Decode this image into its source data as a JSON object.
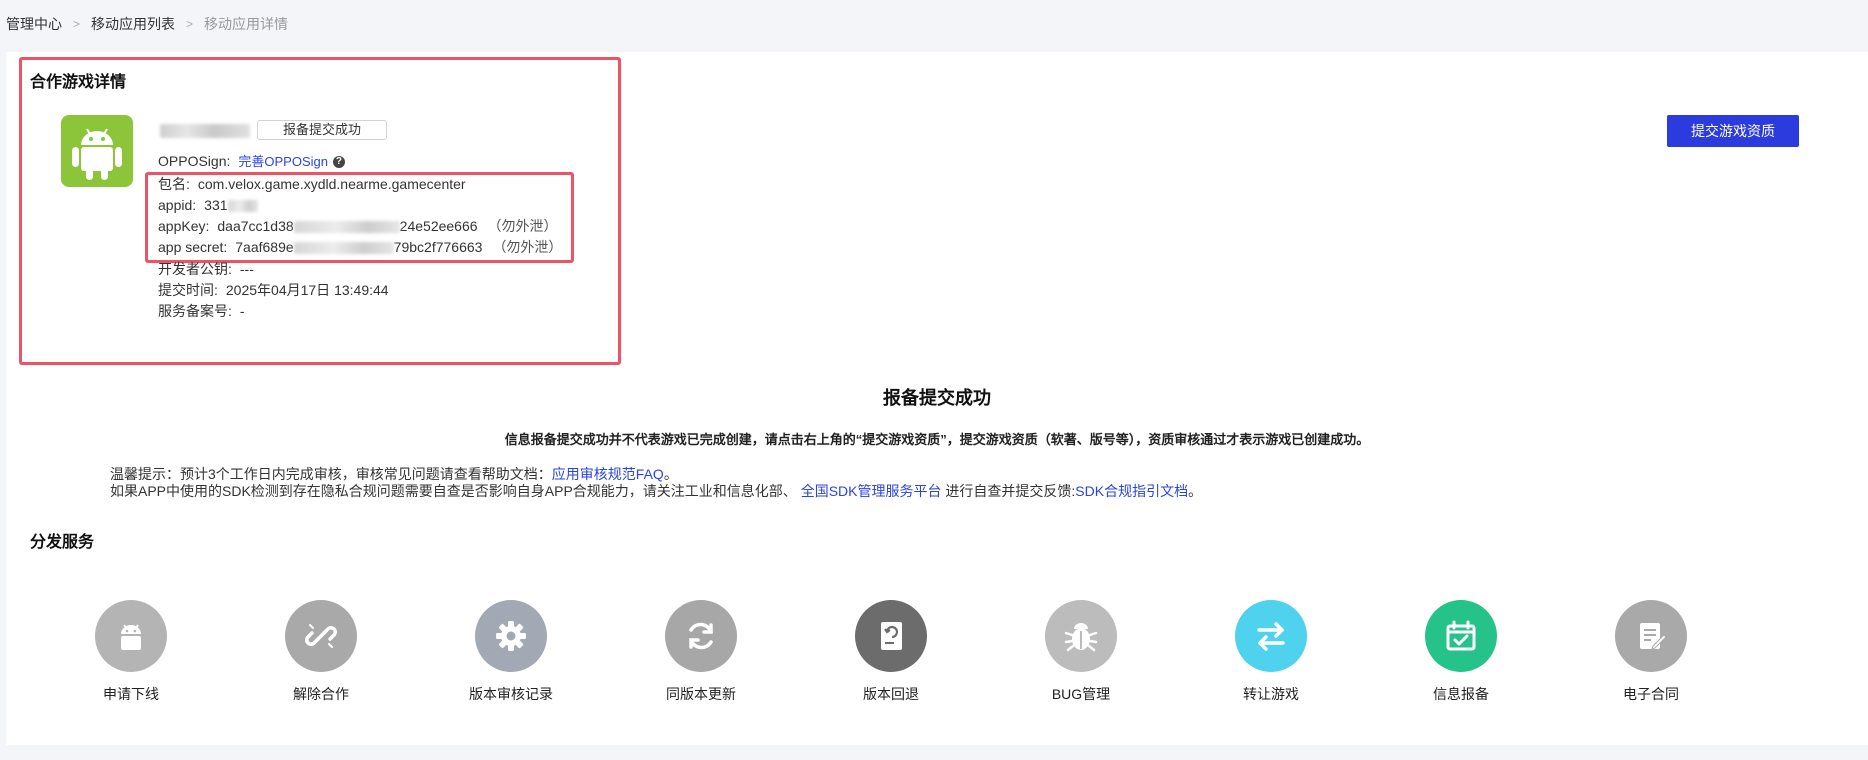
{
  "breadcrumb": {
    "items": [
      "管理中心",
      "移动应用列表",
      "移动应用详情"
    ],
    "separator": ">"
  },
  "detail": {
    "section_title": "合作游戏详情",
    "status_tag": "报备提交成功",
    "oppo_sign": {
      "label": "OPPOSign:",
      "link": "完善OPPOSign",
      "help_icon": "?"
    },
    "package": {
      "label": "包名:",
      "value": "com.velox.game.xydld.nearme.gamecenter"
    },
    "appid": {
      "label": "appid:",
      "value_visible": "331"
    },
    "appkey": {
      "label": "appKey:",
      "value_start": "daa7cc1d38",
      "value_end": "24e52ee666",
      "note": "（勿外泄）"
    },
    "app_secret": {
      "label": "app secret:",
      "value_start": "7aaf689e",
      "value_end": "79bc2f776663",
      "note": "（勿外泄）"
    },
    "dev_key": {
      "label": "开发者公钥:",
      "value": "---"
    },
    "submit_time": {
      "label": "提交时间:",
      "value": "2025年04月17日 13:49:44"
    },
    "service_record": {
      "label": "服务备案号:",
      "value": "-"
    }
  },
  "submit_button": "提交游戏资质",
  "result": {
    "title": "报备提交成功",
    "subtitle": "信息报备提交成功并不代表游戏已完成创建，请点击右上角的“提交游戏资质”，提交游戏资质（软著、版号等），资质审核通过才表示游戏已创建成功。"
  },
  "tips": {
    "line1_text": "温馨提示：预计3个工作日内完成审核，审核常见问题请查看帮助文档：",
    "line1_link": "应用审核规范FAQ",
    "line1_end": "。",
    "line2_text": "如果APP中使用的SDK检测到存在隐私合规问题需要自查是否影响自身APP合规能力，请关注工业和信息化部、",
    "line2_link1": "全国SDK管理服务平台",
    "line2_mid": "进行自查并提交反馈:",
    "line2_link2": "SDK合规指引文档",
    "line2_end": "。"
  },
  "services": {
    "title": "分发服务",
    "items": [
      {
        "label": "申请下线",
        "icon": "android-icon",
        "color": "#b4b4b4"
      },
      {
        "label": "解除合作",
        "icon": "unlink-icon",
        "color": "#a9a9a9"
      },
      {
        "label": "版本审核记录",
        "icon": "gear-icon",
        "color": "#a2a8b4"
      },
      {
        "label": "同版本更新",
        "icon": "refresh-icon",
        "color": "#a7a7a7"
      },
      {
        "label": "版本回退",
        "icon": "rollback-doc-icon",
        "color": "#6c6c6c"
      },
      {
        "label": "BUG管理",
        "icon": "bug-icon",
        "color": "#bcbcbc"
      },
      {
        "label": "转让游戏",
        "icon": "transfer-icon",
        "color": "#4fd2ee"
      },
      {
        "label": "信息报备",
        "icon": "calendar-check-icon",
        "color": "#25c28a"
      },
      {
        "label": "电子合同",
        "icon": "contract-icon",
        "color": "#a9a9a9"
      }
    ]
  },
  "colors": {
    "primary": "#2b3bde",
    "link": "#2a44e2",
    "highlight": "#ec5466",
    "android_green": "#8cc43a"
  }
}
